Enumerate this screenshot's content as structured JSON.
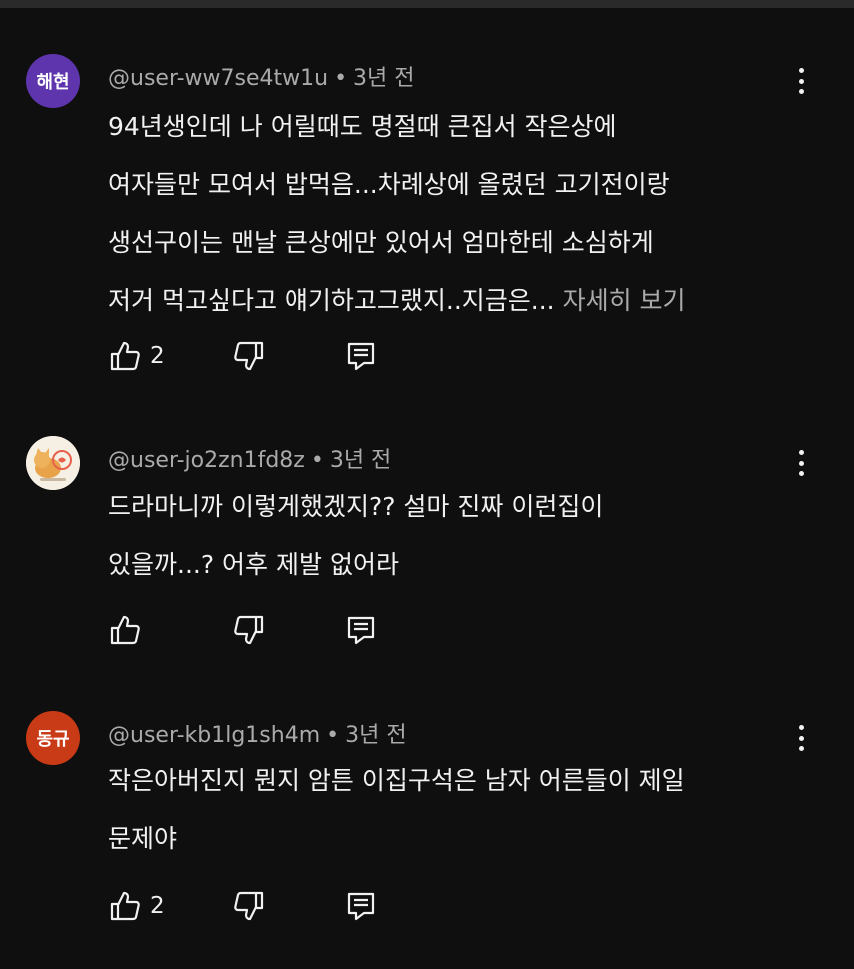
{
  "comments": [
    {
      "avatar_text": "해현",
      "avatar_color": "#5f35ae",
      "author": "@user-ww7se4tw1u",
      "separator": "•",
      "time": "3년 전",
      "lines": [
        "94년생인데 나 어릴때도 명절때 큰집서 작은상에",
        "여자들만 모여서 밥먹음...차례상에 올렸던 고기전이랑",
        "생선구이는 맨날 큰상에만 있어서 엄마한테 소심하게",
        "저거 먹고싶다고 얘기하고그랬지..지금은..."
      ],
      "more_label": "자세히 보기",
      "like_count": "2"
    },
    {
      "avatar_text": "",
      "avatar_color": "#f3ece0",
      "author": "@user-jo2zn1fd8z",
      "separator": "•",
      "time": "3년 전",
      "lines": [
        "드라마니까 이렇게했겠지?? 설마 진짜 이런집이",
        "있을까...? 어후 제발 없어라"
      ],
      "like_count": ""
    },
    {
      "avatar_text": "동규",
      "avatar_color": "#c93a16",
      "author": "@user-kb1lg1sh4m",
      "separator": "•",
      "time": "3년 전",
      "lines": [
        "작은아버진지 뭔지 암튼 이집구석은 남자 어른들이 제일",
        "문제야"
      ],
      "like_count": "2"
    }
  ],
  "icons": {
    "like": "thumb-up-icon",
    "dislike": "thumb-down-icon",
    "reply": "reply-icon",
    "menu": "more-vert-icon"
  }
}
